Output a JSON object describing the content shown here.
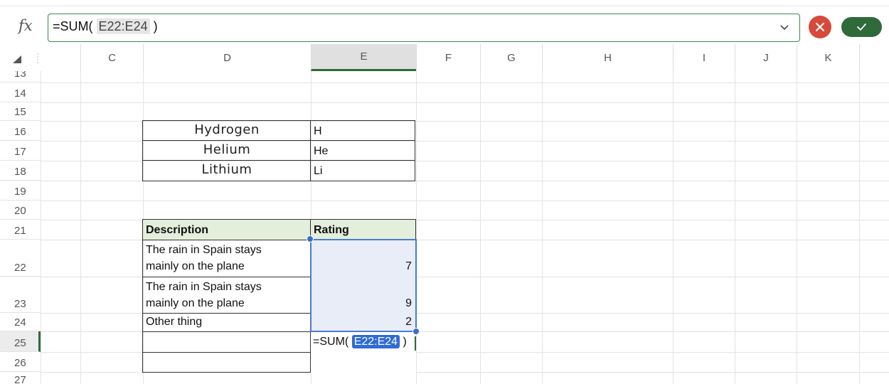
{
  "formula_bar": {
    "fx_label": "fx",
    "formula_prefix": "=SUM(",
    "formula_ref": "E22:E24",
    "formula_suffix": ")"
  },
  "columns": [
    "C",
    "D",
    "E",
    "F",
    "G",
    "H",
    "I",
    "J",
    "K"
  ],
  "selected_column": "E",
  "rows": [
    "13",
    "14",
    "15",
    "16",
    "17",
    "18",
    "19",
    "20",
    "21",
    "22",
    "23",
    "24",
    "25",
    "26",
    "27"
  ],
  "selected_row": "25",
  "elements_table": [
    {
      "name": "Hydrogen",
      "symbol": "H"
    },
    {
      "name": "Helium",
      "symbol": "He"
    },
    {
      "name": "Lithium",
      "symbol": "Li"
    }
  ],
  "ratings_table": {
    "header_description": "Description",
    "header_rating": "Rating",
    "rows": [
      {
        "description_line1": "The rain in Spain stays",
        "description_line2": "mainly on the plane",
        "rating": "7"
      },
      {
        "description_line1": "The rain in Spain stays",
        "description_line2": "mainly on the plane",
        "rating": "9"
      },
      {
        "description_line1": "",
        "description_line2": "Other thing",
        "rating": "2"
      }
    ]
  },
  "edit_cell": {
    "prefix": "=SUM(",
    "ref": "E22:E24",
    "suffix": ")"
  },
  "colors": {
    "accent_green": "#2f6b3a",
    "cancel_red": "#d6493b",
    "selection_blue": "#4a7bd0",
    "header_fill": "#e3efdb"
  }
}
